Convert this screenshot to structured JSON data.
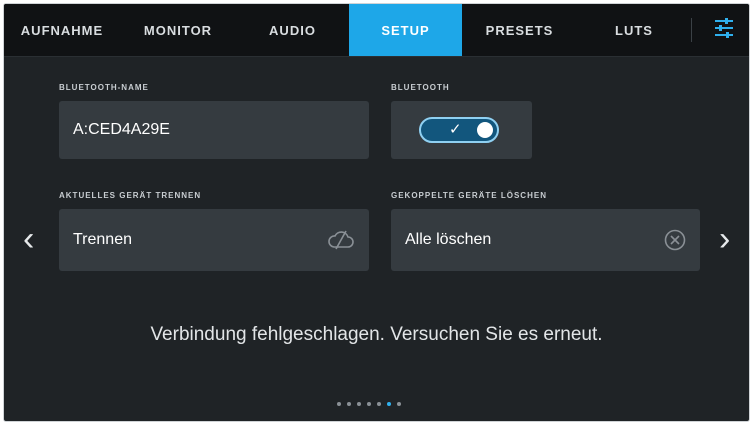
{
  "tabs": [
    {
      "label": "AUFNAHME"
    },
    {
      "label": "MONITOR"
    },
    {
      "label": "AUDIO"
    },
    {
      "label": "SETUP"
    },
    {
      "label": "PRESETS"
    },
    {
      "label": "LUTS"
    }
  ],
  "active_tab": "SETUP",
  "bluetooth_name": {
    "label": "BLUETOOTH-NAME",
    "value": "A:CED4A29E"
  },
  "bluetooth": {
    "label": "BLUETOOTH",
    "enabled": true,
    "check": "✓"
  },
  "disconnect": {
    "label": "AKTUELLES GERÄT TRENNEN",
    "button": "Trennen"
  },
  "clear_paired": {
    "label": "GEKOPPELTE GERÄTE LÖSCHEN",
    "button": "Alle löschen"
  },
  "nav": {
    "prev": "‹",
    "next": "›"
  },
  "status_message": "Verbindung fehlgeschlagen. Versuchen Sie es erneut.",
  "pager": {
    "count": 7,
    "active_index": 5
  },
  "colors": {
    "accent": "#1ea7e8",
    "background": "#1f2326",
    "field": "#353b40"
  }
}
